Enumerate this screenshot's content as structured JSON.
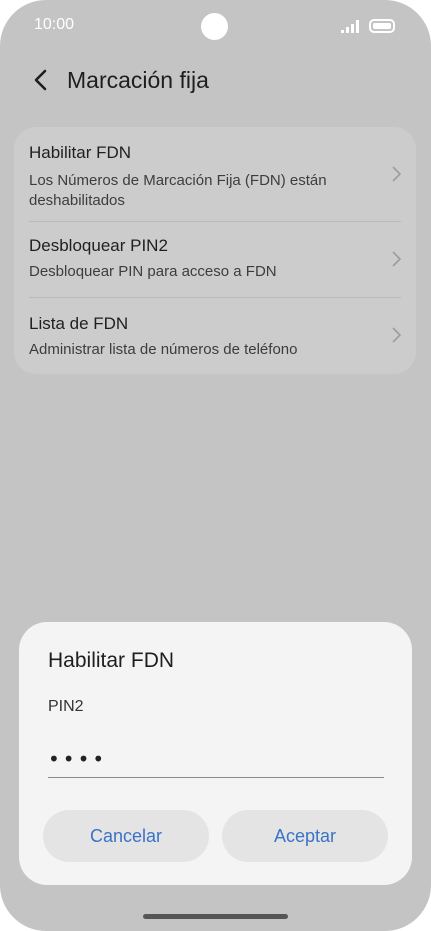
{
  "status_bar": {
    "time": "10:00"
  },
  "header": {
    "title": "Marcación fija"
  },
  "settings": {
    "items": [
      {
        "title": "Habilitar FDN",
        "subtitle": "Los Números de Marcación Fija (FDN) están deshabilitados"
      },
      {
        "title": "Desbloquear PIN2",
        "subtitle": "Desbloquear PIN para acceso a FDN"
      },
      {
        "title": "Lista de FDN",
        "subtitle": "Administrar lista de números de teléfono"
      }
    ]
  },
  "dialog": {
    "title": "Habilitar FDN",
    "field_label": "PIN2",
    "pin_value": "1234",
    "cancel_label": "Cancelar",
    "accept_label": "Aceptar"
  },
  "colors": {
    "accent": "#3a72c7",
    "overlay": "#c4c4c4",
    "dialog_bg": "#f4f4f4"
  }
}
